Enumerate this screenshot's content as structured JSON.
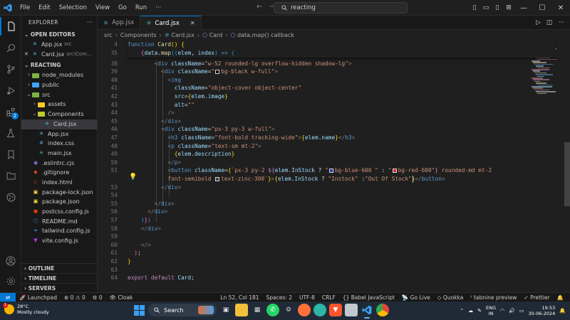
{
  "titlebar": {
    "menu": [
      "File",
      "Edit",
      "Selection",
      "View",
      "Go",
      "Run",
      "···"
    ],
    "search_text": "reacting"
  },
  "sidebar": {
    "explorer_title": "EXPLORER",
    "open_editors_title": "OPEN EDITORS",
    "open_editors": [
      {
        "name": "App.jsx",
        "path": "src"
      },
      {
        "name": "Card.jsx",
        "path": "src\\Com..."
      }
    ],
    "project_title": "REACTING",
    "tree": [
      {
        "name": "node_modules",
        "depth": 1,
        "kind": "folder",
        "color": "#7cb342"
      },
      {
        "name": "public",
        "depth": 1,
        "kind": "folder",
        "color": "#42a5f5"
      },
      {
        "name": "src",
        "depth": 1,
        "kind": "folder-open",
        "color": "#7cb342"
      },
      {
        "name": "assets",
        "depth": 2,
        "kind": "folder",
        "color": "#ffca28"
      },
      {
        "name": "Components",
        "depth": 2,
        "kind": "folder-open",
        "color": "#c0ca33"
      },
      {
        "name": "Card.jsx",
        "depth": 3,
        "kind": "react",
        "selected": true
      },
      {
        "name": "App.jsx",
        "depth": 2,
        "kind": "react"
      },
      {
        "name": "index.css",
        "depth": 2,
        "kind": "css"
      },
      {
        "name": "main.jsx",
        "depth": 2,
        "kind": "react"
      },
      {
        "name": ".eslintrc.cjs",
        "depth": 1,
        "kind": "eslint"
      },
      {
        "name": ".gitignore",
        "depth": 1,
        "kind": "git"
      },
      {
        "name": "index.html",
        "depth": 1,
        "kind": "html"
      },
      {
        "name": "package-lock.json",
        "depth": 1,
        "kind": "npm"
      },
      {
        "name": "package.json",
        "depth": 1,
        "kind": "npm"
      },
      {
        "name": "postcss.config.js",
        "depth": 1,
        "kind": "postcss"
      },
      {
        "name": "README.md",
        "depth": 1,
        "kind": "md"
      },
      {
        "name": "tailwind.config.js",
        "depth": 1,
        "kind": "tailwind"
      },
      {
        "name": "vite.config.js",
        "depth": 1,
        "kind": "vite"
      }
    ],
    "bottom_sections": [
      "OUTLINE",
      "TIMELINE",
      "SERVERS"
    ]
  },
  "activity_badge": "2",
  "tabs": [
    {
      "name": "App.jsx",
      "active": false
    },
    {
      "name": "Card.jsx",
      "active": true
    }
  ],
  "breadcrumb": [
    "src",
    "Components",
    "Card.jsx",
    "Card",
    "data.map() callback"
  ],
  "editor": {
    "current_line": 52,
    "lines": [
      {
        "n": 4,
        "tokens": [
          [
            "kb",
            "function "
          ],
          [
            "fn",
            "Card"
          ],
          [
            "br1",
            "() {"
          ]
        ],
        "indent": 0
      },
      {
        "n": 35,
        "tokens": [
          [
            "br2",
            "{"
          ],
          [
            "var",
            "data"
          ],
          [
            "tx",
            "."
          ],
          [
            "fn",
            "map"
          ],
          [
            "br3",
            "(("
          ],
          [
            "var",
            "elem"
          ],
          [
            "tx",
            ", "
          ],
          [
            "var",
            "index"
          ],
          [
            "br3",
            ")"
          ],
          [
            "kb",
            " => "
          ],
          [
            "br3",
            "("
          ]
        ],
        "indent": 2
      },
      {
        "n": 38,
        "tokens": [
          [
            "pn",
            "<"
          ],
          [
            "tag",
            "div "
          ],
          [
            "attr",
            "className"
          ],
          [
            "tx",
            "="
          ],
          [
            "str",
            "\"w-52 rounded-lg overflow-hidden shadow-lg\""
          ],
          [
            "pn",
            ">"
          ]
        ],
        "indent": 4
      },
      {
        "n": 39,
        "tokens": [
          [
            "pn",
            "<"
          ],
          [
            "tag",
            "div "
          ],
          [
            "attr",
            "className"
          ],
          [
            "tx",
            "="
          ],
          [
            "str",
            "\""
          ],
          [
            "swatch",
            "#000000"
          ],
          [
            "str",
            "bg-black w-full\""
          ],
          [
            "pn",
            ">"
          ]
        ],
        "indent": 5
      },
      {
        "n": 40,
        "tokens": [
          [
            "pn",
            "<"
          ],
          [
            "tag",
            "img"
          ]
        ],
        "indent": 6
      },
      {
        "n": 41,
        "tokens": [
          [
            "attr",
            "className"
          ],
          [
            "tx",
            "="
          ],
          [
            "str",
            "\"object-cover object-center\""
          ]
        ],
        "indent": 7
      },
      {
        "n": 42,
        "tokens": [
          [
            "attr",
            "src"
          ],
          [
            "tx",
            "="
          ],
          [
            "br1",
            "{"
          ],
          [
            "var",
            "elem"
          ],
          [
            "tx",
            "."
          ],
          [
            "var",
            "image"
          ],
          [
            "br1",
            "}"
          ]
        ],
        "indent": 7
      },
      {
        "n": 43,
        "tokens": [
          [
            "attr",
            "alt"
          ],
          [
            "tx",
            "="
          ],
          [
            "str",
            "\"\""
          ]
        ],
        "indent": 7
      },
      {
        "n": 44,
        "tokens": [
          [
            "pn",
            "/>"
          ]
        ],
        "indent": 6
      },
      {
        "n": 45,
        "tokens": [
          [
            "pn",
            "</"
          ],
          [
            "tag",
            "div"
          ],
          [
            "pn",
            ">"
          ]
        ],
        "indent": 5
      },
      {
        "n": 46,
        "tokens": [
          [
            "pn",
            "<"
          ],
          [
            "tag",
            "div "
          ],
          [
            "attr",
            "className"
          ],
          [
            "tx",
            "="
          ],
          [
            "str",
            "\"px-3 py-3 w-full\""
          ],
          [
            "pn",
            ">"
          ]
        ],
        "indent": 5
      },
      {
        "n": 47,
        "tokens": [
          [
            "pn",
            "<"
          ],
          [
            "tag",
            "h3 "
          ],
          [
            "attr",
            "className"
          ],
          [
            "tx",
            "="
          ],
          [
            "str",
            "\"font-bold tracking-wide\""
          ],
          [
            "pn",
            ">"
          ],
          [
            "br1",
            "{"
          ],
          [
            "var",
            "elem"
          ],
          [
            "tx",
            "."
          ],
          [
            "var",
            "name"
          ],
          [
            "br1",
            "}"
          ],
          [
            "pn",
            "</"
          ],
          [
            "tag",
            "h3"
          ],
          [
            "pn",
            ">"
          ]
        ],
        "indent": 6
      },
      {
        "n": 48,
        "tokens": [
          [
            "pn",
            "<"
          ],
          [
            "tag",
            "p "
          ],
          [
            "attr",
            "className"
          ],
          [
            "tx",
            "="
          ],
          [
            "str",
            "\"text-sm mt-2\""
          ],
          [
            "pn",
            ">"
          ]
        ],
        "indent": 6
      },
      {
        "n": 49,
        "tokens": [
          [
            "br1",
            "{"
          ],
          [
            "var",
            "elem"
          ],
          [
            "tx",
            "."
          ],
          [
            "var",
            "description"
          ],
          [
            "br1",
            "}"
          ]
        ],
        "indent": 7
      },
      {
        "n": 50,
        "tokens": [
          [
            "pn",
            "</"
          ],
          [
            "tag",
            "p"
          ],
          [
            "pn",
            ">"
          ]
        ],
        "indent": 6
      },
      {
        "n": 51,
        "tokens": [
          [
            "pn",
            "<"
          ],
          [
            "tag",
            "button "
          ],
          [
            "attr",
            "className"
          ],
          [
            "tx",
            "="
          ],
          [
            "br1",
            "{"
          ],
          [
            "str",
            "`px-3 py-2 "
          ],
          [
            "kw",
            "${"
          ],
          [
            "var",
            "elem"
          ],
          [
            "tx",
            "."
          ],
          [
            "var",
            "InStock"
          ],
          [
            "tx",
            " ? "
          ],
          [
            "str",
            "\""
          ],
          [
            "swatch",
            "#1e40af"
          ],
          [
            "str",
            "bg-blue-600 \""
          ],
          [
            "tx",
            " : "
          ],
          [
            "str",
            "\""
          ],
          [
            "swatch",
            "#dc2626"
          ],
          [
            "str",
            "bg-red-600\""
          ],
          [
            "kw",
            "}"
          ],
          [
            "str",
            " rounded-md mt-2"
          ]
        ],
        "indent": 6
      },
      {
        "n": 52,
        "tokens": [
          [
            "str",
            "font-semibold "
          ],
          [
            "swatch",
            "#3f3f46"
          ],
          [
            "str",
            "text-zinc-300`"
          ],
          [
            "br1",
            "}"
          ],
          [
            "pn",
            ">"
          ],
          [
            "br1",
            "{"
          ],
          [
            "var",
            "elem"
          ],
          [
            "tx",
            "."
          ],
          [
            "var",
            "InStock"
          ],
          [
            "tx",
            " ? "
          ],
          [
            "str",
            "\"Instock\""
          ],
          [
            "tx",
            " :"
          ],
          [
            "str",
            "\"Out Of Stock\""
          ],
          [
            "br1",
            "}"
          ],
          [
            "pn",
            "</"
          ],
          [
            "tag",
            "button"
          ],
          [
            "pn",
            ">"
          ]
        ],
        "indent": 6,
        "cont": true
      },
      {
        "n": 53,
        "tokens": [
          [
            "pn",
            "</"
          ],
          [
            "tag",
            "div"
          ],
          [
            "pn",
            ">"
          ]
        ],
        "indent": 5
      },
      {
        "n": 54,
        "tokens": [],
        "indent": 0
      },
      {
        "n": 55,
        "tokens": [
          [
            "pn",
            "</"
          ],
          [
            "tag",
            "div"
          ],
          [
            "pn",
            ">"
          ]
        ],
        "indent": 4
      },
      {
        "n": 56,
        "tokens": [
          [
            "pn",
            "</"
          ],
          [
            "tag",
            "div"
          ],
          [
            "pn",
            ">"
          ]
        ],
        "indent": 3
      },
      {
        "n": 57,
        "tokens": [
          [
            "br3",
            ")"
          ],
          [
            "br2",
            "}"
          ],
          [
            "pn",
            ")"
          ]
        ],
        "indent": 2
      },
      {
        "n": 58,
        "tokens": [
          [
            "pn",
            "</"
          ],
          [
            "tag",
            "div"
          ],
          [
            "pn",
            ">"
          ]
        ],
        "indent": 2
      },
      {
        "n": 59,
        "tokens": [],
        "indent": 0
      },
      {
        "n": 60,
        "tokens": [
          [
            "pn",
            "</>"
          ]
        ],
        "indent": 2
      },
      {
        "n": 61,
        "tokens": [
          [
            "br2",
            ")"
          ],
          [
            "tx",
            ";"
          ]
        ],
        "indent": 1
      },
      {
        "n": 62,
        "tokens": [
          [
            "br1",
            "}"
          ]
        ],
        "indent": 0
      },
      {
        "n": 63,
        "tokens": [],
        "indent": 0
      },
      {
        "n": 64,
        "tokens": [
          [
            "kw",
            "export "
          ],
          [
            "kw",
            "default "
          ],
          [
            "var",
            "Card"
          ],
          [
            "tx",
            ";"
          ]
        ],
        "indent": 0
      }
    ]
  },
  "statusbar": {
    "left": [
      "Launchpad",
      "⊗ 0  ⚠ 0",
      "⚙ 0",
      "Cloak"
    ],
    "right": [
      "Ln 52, Col 181",
      "Spaces: 2",
      "UTF-8",
      "CRLF",
      "{} Babel JavaScript",
      "Go Live",
      "Quokka",
      "tabnine preview",
      "Prettier"
    ]
  },
  "taskbar": {
    "weather_temp": "28°C",
    "weather_desc": "Mostly cloudy",
    "weather_badge": "1",
    "search_label": "Search",
    "lang_top": "ENG",
    "lang_bottom": "IN",
    "time": "19:53",
    "date": "30-06-2024"
  }
}
